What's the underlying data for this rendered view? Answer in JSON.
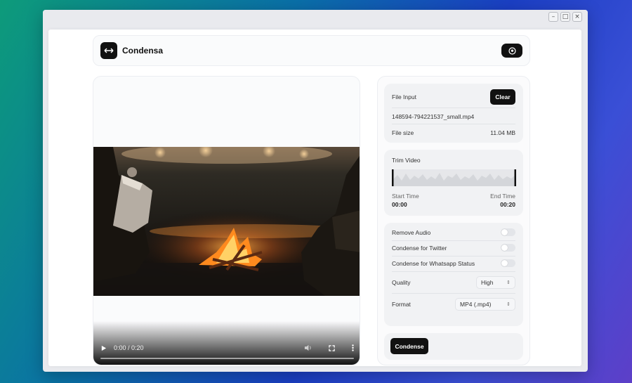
{
  "window": {
    "controls": {
      "minimize": "–",
      "maximize": "□",
      "close": "×"
    }
  },
  "header": {
    "brand": "Condensa",
    "logo_icon": "arrows-icon",
    "github_icon": "github-icon"
  },
  "video": {
    "current_time": "0:00 / 0:20"
  },
  "file_input": {
    "title": "File Input",
    "clear_label": "Clear",
    "file_name": "148594-794221537_small.mp4",
    "size_label": "File size",
    "size_value": "11.04 MB"
  },
  "trim": {
    "title": "Trim Video",
    "start_label": "Start Time",
    "start_value": "00:00",
    "end_label": "End Time",
    "end_value": "00:20"
  },
  "options": {
    "remove_audio": "Remove Audio",
    "condense_twitter": "Condense for Twitter",
    "condense_whatsapp": "Condense for Whatsapp Status",
    "quality_label": "Quality",
    "quality_value": "High",
    "format_label": "Format",
    "format_value": "MP4 (.mp4)"
  },
  "action": {
    "condense_label": "Condense"
  },
  "colors": {
    "accent": "#111111",
    "panel": "#f1f2f4"
  }
}
